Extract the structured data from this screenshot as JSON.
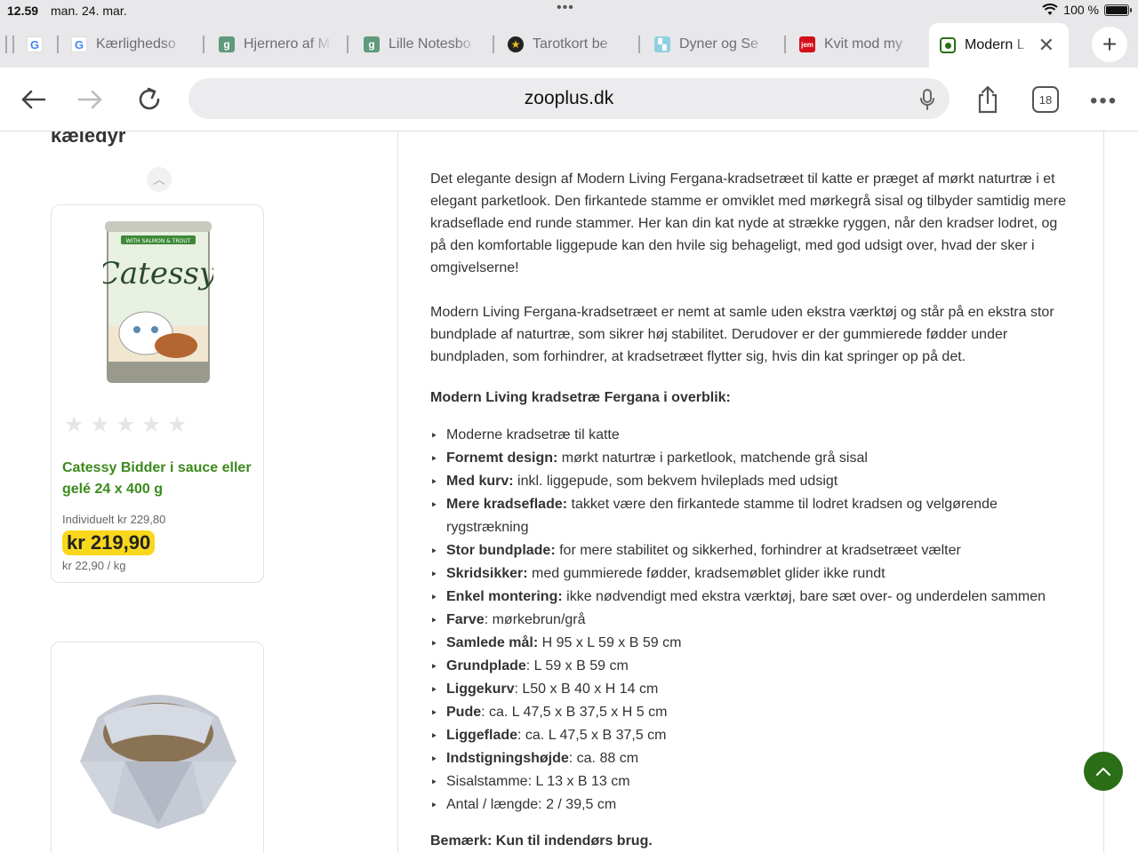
{
  "status": {
    "time": "12.59",
    "date": "man. 24. mar.",
    "battery_text": "100 %"
  },
  "tabs": [
    {
      "label": "",
      "favicon": "google-icon"
    },
    {
      "label": "Kærlighedso",
      "favicon": "google-icon"
    },
    {
      "label": "Hjernero af M",
      "favicon": "g-tile-icon"
    },
    {
      "label": "Lille Notesbo",
      "favicon": "g-tile-icon"
    },
    {
      "label": "Tarotkort be",
      "favicon": "star-icon"
    },
    {
      "label": "Dyner og Se",
      "favicon": "jysk-icon"
    },
    {
      "label": "Kvit mod my",
      "favicon": "jem-icon"
    },
    {
      "label": "Modern L",
      "favicon": "zooplus-icon",
      "active": true
    }
  ],
  "toolbar": {
    "url": "zooplus.dk",
    "tab_count": "18"
  },
  "sidebar": {
    "heading": "kæledyr",
    "product1": {
      "name": "Catessy Bidder i sauce eller gelé 24 x 400 g",
      "individual_price": "Individuelt kr 229,80",
      "price": "kr 219,90",
      "unit_price": "kr 22,90 / kg",
      "rating": 0,
      "can_label_top": "WITH SALMON & TROUT",
      "can_brand": "Catessy"
    }
  },
  "content": {
    "paragraph1": "Det elegante design af Modern Living Fergana-kradsetræet til katte er præget af mørkt naturtræ i et elegant parketlook. Den firkantede stamme er omviklet med mørkegrå sisal og tilbyder samtidig mere kradseflade end runde stammer. Her kan din kat nyde at strække ryggen, når den kradser lodret, og på den komfortable liggepude kan den hvile sig behageligt, med god udsigt over, hvad der sker i omgivelserne!",
    "paragraph2": "Modern Living Fergana-kradsetræet er nemt at samle uden ekstra værktøj og står på en ekstra stor bundplade af naturtræ, som sikrer høj stabilitet. Derudover er der gummierede fødder under bundpladen, som forhindrer, at kradsetræet flytter sig, hvis din kat springer op på det.",
    "overview_heading": "Modern Living kradsetræ Fergana i overblik:",
    "bullets": [
      {
        "term": "",
        "text": "Moderne kradsetræ til katte"
      },
      {
        "term": "Fornemt design:",
        "text": " mørkt naturtræ i parketlook, matchende grå sisal"
      },
      {
        "term": "Med kurv:",
        "text": " inkl. liggepude, som bekvem hvileplads med udsigt"
      },
      {
        "term": "Mere kradseflade:",
        "text": " takket være den firkantede stamme til lodret kradsen og velgørende rygstrækning"
      },
      {
        "term": "Stor bundplade:",
        "text": " for mere stabilitet og sikkerhed, forhindrer at kradsetræet vælter"
      },
      {
        "term": "Skridsikker:",
        "text": " med gummierede fødder, kradsemøblet glider ikke rundt"
      },
      {
        "term": "Enkel montering:",
        "text": " ikke nødvendigt med ekstra værktøj, bare sæt over- og underdelen sammen"
      },
      {
        "term": "Farve",
        "text": ": mørkebrun/grå"
      },
      {
        "term": "Samlede mål:",
        "text": " H 95 x L 59 x B 59 cm"
      },
      {
        "term": "Grundplade",
        "text": ": L 59 x B 59 cm"
      },
      {
        "term": "Liggekurv",
        "text": ": L50 x B 40 x H 14 cm"
      },
      {
        "term": "Pude",
        "text": ": ca. L 47,5 x B 37,5 x H 5 cm"
      },
      {
        "term": "Liggeflade",
        "text": ": ca. L 47,5 x B 37,5 cm"
      },
      {
        "term": "Indstigningshøjde",
        "text": ": ca. 88 cm"
      },
      {
        "term": "",
        "text": "Sisalstamme: L 13 x B 13 cm"
      },
      {
        "term": "",
        "text": "Antal / længde: 2 / 39,5 cm"
      }
    ],
    "note": "Bemærk: Kun til indendørs brug."
  },
  "colors": {
    "accent_green": "#3b8a1a",
    "price_yellow": "#f9d71c",
    "back_to_top": "#2a6e17"
  }
}
